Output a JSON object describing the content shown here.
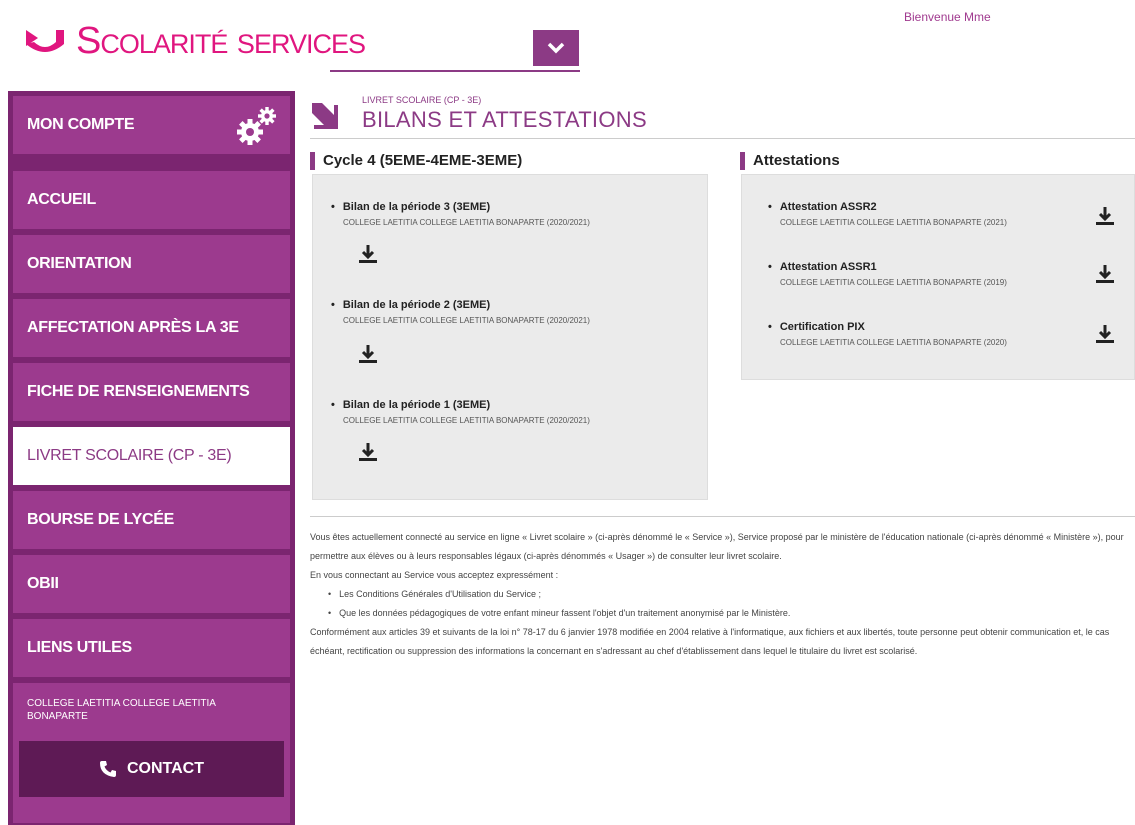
{
  "header": {
    "logo_text": "Scolarité services",
    "welcome": "Bienvenue Mme"
  },
  "sidebar": {
    "items": [
      {
        "label": "MON COMPTE"
      },
      {
        "label": "ACCUEIL"
      },
      {
        "label": "ORIENTATION"
      },
      {
        "label": "AFFECTATION APRÈS LA 3e"
      },
      {
        "label": "FICHE DE RENSEIGNEMENTS"
      },
      {
        "label": "LIVRET SCOLAIRE (CP - 3e)"
      },
      {
        "label": "BOURSE DE LYCÉE"
      },
      {
        "label": "OBII"
      },
      {
        "label": "LIENS UTILES"
      }
    ],
    "college": "COLLEGE LAETITIA COLLEGE LAETITIA BONAPARTE",
    "contact_label": "CONTACT"
  },
  "main": {
    "breadcrumb": "LIVRET SCOLAIRE (CP - 3e)",
    "title": "BILANS ET ATTESTATIONS",
    "cycle": {
      "title": "Cycle 4 (5EME-4EME-3EME)",
      "entries": [
        {
          "title": "Bilan de la période 3 (3EME)",
          "sub": "COLLEGE LAETITIA COLLEGE LAETITIA BONAPARTE (2020/2021)"
        },
        {
          "title": "Bilan de la période 2 (3EME)",
          "sub": "COLLEGE LAETITIA COLLEGE LAETITIA BONAPARTE (2020/2021)"
        },
        {
          "title": "Bilan de la période 1 (3EME)",
          "sub": "COLLEGE LAETITIA COLLEGE LAETITIA BONAPARTE (2020/2021)"
        }
      ]
    },
    "attestations": {
      "title": "Attestations",
      "entries": [
        {
          "title": "Attestation ASSR2",
          "sub": "COLLEGE LAETITIA COLLEGE LAETITIA BONAPARTE (2021)"
        },
        {
          "title": "Attestation ASSR1",
          "sub": "COLLEGE LAETITIA COLLEGE LAETITIA BONAPARTE (2019)"
        },
        {
          "title": "Certification PIX",
          "sub": "COLLEGE LAETITIA COLLEGE LAETITIA BONAPARTE (2020)"
        }
      ]
    }
  },
  "legal": {
    "p1": "Vous êtes actuellement connecté au service en ligne « Livret scolaire » (ci-après dénommé le « Service »), Service proposé par le ministère de l'éducation nationale (ci-après dénommé « Ministère »), pour permettre aux élèves ou à leurs responsables légaux (ci-après dénommés « Usager ») de consulter leur livret scolaire.",
    "p2": "En vous connectant au Service vous acceptez expressément :",
    "li1": "Les Conditions Générales d'Utilisation du Service ;",
    "li2": "Que les données pédagogiques de votre enfant mineur fassent l'objet d'un traitement anonymisé par le Ministère.",
    "p3": "Conformément aux articles 39 et suivants de la loi n° 78-17 du 6 janvier 1978 modifiée en 2004 relative à l'informatique, aux fichiers et aux libertés, toute personne peut obtenir communication et, le cas échéant, rectification ou suppression des informations la concernant en s'adressant au chef d'établissement dans lequel le titulaire du livret est scolarisé."
  },
  "colors": {
    "brand_pink": "#e0167f",
    "brand_purple": "#8c3a85",
    "sidebar_dark": "#7b2570"
  }
}
